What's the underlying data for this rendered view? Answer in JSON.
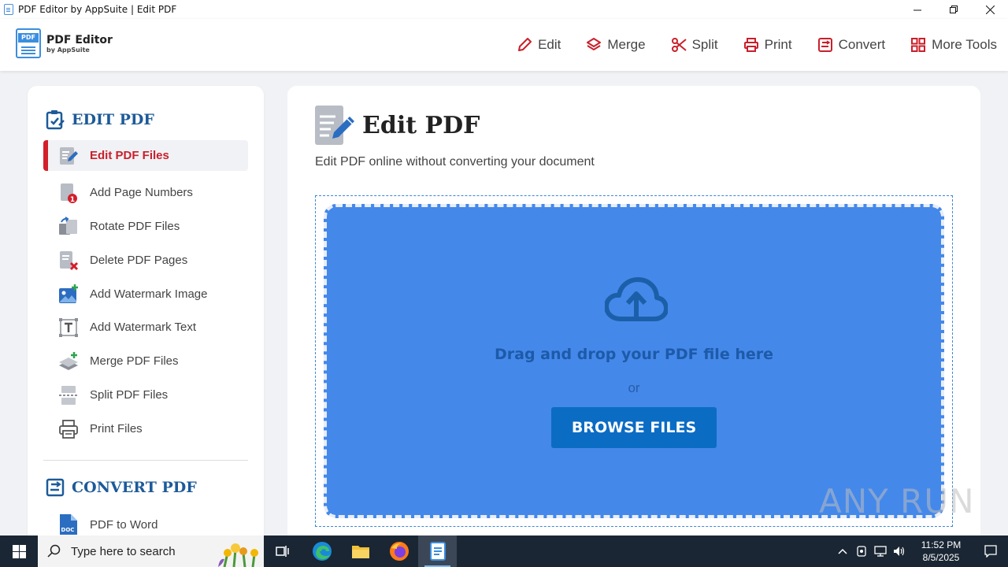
{
  "window": {
    "title": "PDF Editor by AppSuite | Edit PDF",
    "minimize_icon": "minimize-icon",
    "maximize_icon": "restore-icon",
    "close_icon": "close-icon"
  },
  "header": {
    "logo_badge": "PDF",
    "logo_title": "PDF Editor",
    "logo_subtitle": "by AppSuite",
    "nav": [
      {
        "label": "Edit",
        "icon": "pencil-icon"
      },
      {
        "label": "Merge",
        "icon": "layers-icon"
      },
      {
        "label": "Split",
        "icon": "scissors-icon"
      },
      {
        "label": "Print",
        "icon": "printer-icon"
      },
      {
        "label": "Convert",
        "icon": "convert-icon"
      },
      {
        "label": "More Tools",
        "icon": "grid-icon"
      }
    ]
  },
  "sidebar": {
    "edit_section_title": "EDIT PDF",
    "items": [
      {
        "label": "Edit PDF Files",
        "icon": "edit-document-icon",
        "active": true
      },
      {
        "label": "Add Page Numbers",
        "icon": "page-number-icon"
      },
      {
        "label": "Rotate PDF Files",
        "icon": "rotate-icon"
      },
      {
        "label": "Delete PDF Pages",
        "icon": "delete-page-icon"
      },
      {
        "label": "Add Watermark Image",
        "icon": "image-add-icon"
      },
      {
        "label": "Add Watermark Text",
        "icon": "text-box-icon"
      },
      {
        "label": "Merge PDF Files",
        "icon": "stack-icon"
      },
      {
        "label": "Split PDF Files",
        "icon": "split-icon"
      },
      {
        "label": "Print Files",
        "icon": "printer-icon"
      }
    ],
    "convert_section_title": "CONVERT PDF",
    "convert_items": [
      {
        "label": "PDF to Word",
        "icon": "doc-icon",
        "badge": "DOC"
      }
    ]
  },
  "main": {
    "title": "Edit PDF",
    "subtitle": "Edit PDF online without converting your document",
    "drop_text": "Drag and drop your PDF file here",
    "or_text": "or",
    "browse_label": "BROWSE FILES",
    "upload_icon": "cloud-upload-icon"
  },
  "watermark": "ANY RUN",
  "taskbar": {
    "search_placeholder": "Type here to search",
    "time": "11:52 PM",
    "date": "8/5/2025"
  },
  "colors": {
    "accent_red": "#c8202b",
    "brand_blue": "#1d5a99",
    "drop_zone": "#4488ea",
    "button": "#0b6cc4"
  }
}
